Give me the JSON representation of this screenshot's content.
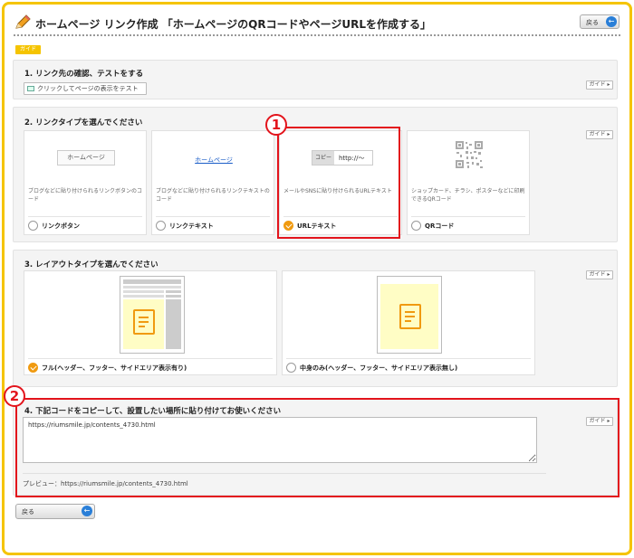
{
  "header": {
    "title": "ホームページ リンク作成 「ホームページのQRコードやページURLを作成する」",
    "back_label": "戻る",
    "guide_tag": "ガイド"
  },
  "section1": {
    "title": "1. リンク先の確認、テストをする",
    "test_button": "クリックしてページの表示をテスト",
    "guide": "ガイド ▸"
  },
  "section2": {
    "title": "2. リンクタイプを選んでください",
    "guide": "ガイド ▸",
    "options": [
      {
        "preview": "ホームページ",
        "desc": "ブログなどに貼り付けられるリンクボタンのコード",
        "label": "リンクボタン",
        "selected": false
      },
      {
        "preview": "ホームページ",
        "desc": "ブログなどに貼り付けられるリンクテキストのコード",
        "label": "リンクテキスト",
        "selected": false
      },
      {
        "preview_copy": "コピー",
        "preview_url": "http://〜",
        "desc": "メールやSNSに貼り付けられるURLテキスト",
        "label": "URLテキスト",
        "selected": true
      },
      {
        "preview": "qr-code-icon",
        "desc": "ショップカード、チラシ、ポスターなどに印刷できるQRコード",
        "label": "QRコード",
        "selected": false
      }
    ]
  },
  "section3": {
    "title": "3. レイアウトタイプを選んでください",
    "guide": "ガイド ▸",
    "options": [
      {
        "label": "フル(ヘッダー、フッター、サイドエリア表示有り)",
        "selected": true
      },
      {
        "label": "中身のみ(ヘッダー、フッター、サイドエリア表示無し)",
        "selected": false
      }
    ]
  },
  "section4": {
    "title": "4. 下記コードをコピーして、設置したい場所に貼り付けてお使いください",
    "guide": "ガイド ▸",
    "code": "https://riumsmile.jp/contents_4730.html",
    "preview": "プレビュー：https://riumsmile.jp/contents_4730.html"
  },
  "footer": {
    "back_label": "戻る"
  },
  "annotations": {
    "badge1": "1",
    "badge2": "2"
  },
  "colors": {
    "accent": "#f5c400",
    "selected": "#f09a10",
    "highlight": "#e3141c",
    "link": "#1a5dc8"
  }
}
